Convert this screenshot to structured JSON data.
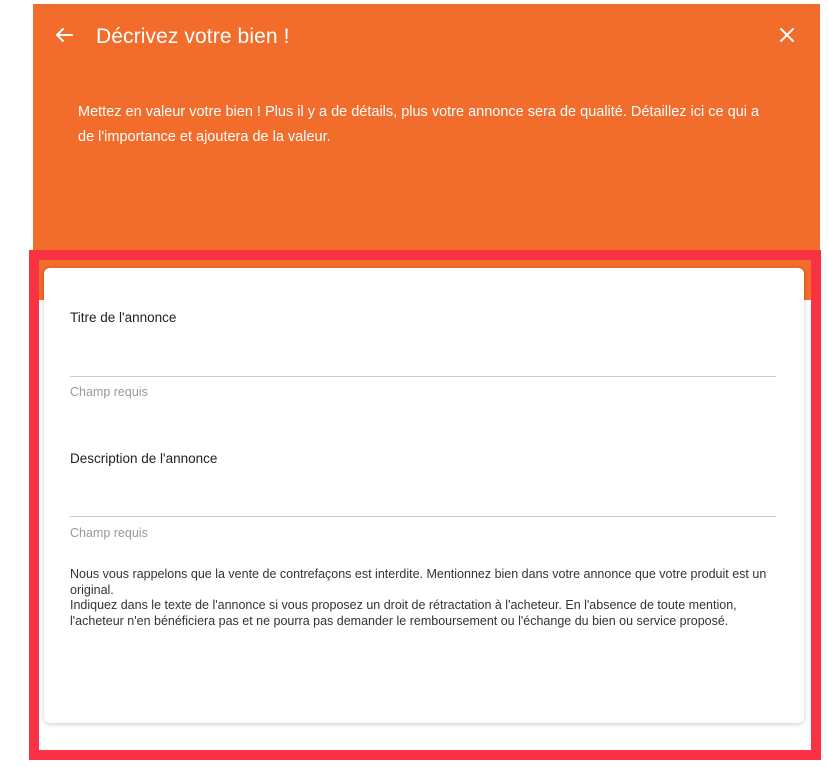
{
  "header": {
    "title": "Décrivez votre bien !",
    "back_icon": "back-arrow-icon",
    "close_icon": "close-icon",
    "intro": "Mettez en valeur votre bien ! Plus il y a de détails, plus votre annonce sera de qualité. Détaillez ici ce qui a de l'importance et ajoutera de la valeur.",
    "background": "#f26c2c"
  },
  "form": {
    "title_field": {
      "label": "Titre de l'annonce",
      "value": "",
      "helper": "Champ requis"
    },
    "description_field": {
      "label": "Description de l'annonce",
      "value": "",
      "helper": "Champ requis"
    },
    "notice": {
      "paragraph1": "Nous vous rappelons que la vente de contrefaçons est interdite. Mentionnez bien dans votre annonce que votre produit est un original.",
      "paragraph2": "Indiquez dans le texte de l'annonce si vous proposez un droit de rétractation à l'acheteur. En l'absence de toute mention, l'acheteur n'en bénéficiera pas et ne pourra pas demander le remboursement ou l'échange du bien ou service proposé."
    }
  },
  "highlight_color": "#fa3344"
}
